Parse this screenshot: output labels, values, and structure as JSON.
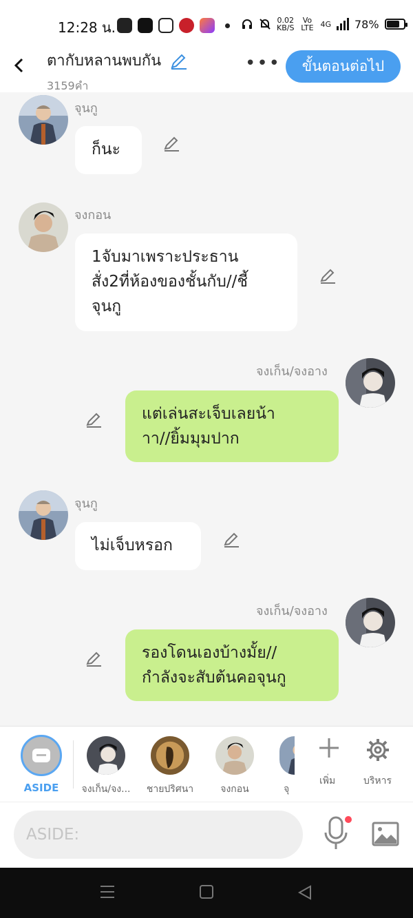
{
  "status_bar": {
    "time": "12:28 น.",
    "speed_value": "0.02",
    "speed_unit": "KB/S",
    "volte": "Vo LTE",
    "network": "4G",
    "battery": "78%",
    "battery_level": 0.78
  },
  "header": {
    "title": "ตากับหลานพบกัน",
    "word_count": "3159คำ",
    "next_button": "ขั้นตอนต่อไป"
  },
  "messages": [
    {
      "side": "left",
      "sender": "จุนกู",
      "lines": [
        "ก็นะ"
      ],
      "avatar": "jungu"
    },
    {
      "side": "left",
      "sender": "จงกอน",
      "lines": [
        "1จับมาเพราะประธาน",
        "สั่ง2ที่ห้องของชั้นกับ//ชี้",
        "จุนกู"
      ],
      "avatar": "jonggon"
    },
    {
      "side": "right",
      "sender": "จงเก็น/จงอาง",
      "lines": [
        "แต่เล่นสะเจ็บเลยน้า",
        "าา//ยิ้มมุมปาก"
      ],
      "avatar": "jonggen"
    },
    {
      "side": "left",
      "sender": "จุนกู",
      "lines": [
        "ไม่เจ็บหรอก"
      ],
      "avatar": "jungu"
    },
    {
      "side": "right",
      "sender": "จงเก็น/จงอาง",
      "lines": [
        "รองโดนเองบ้างมั้ย//",
        "กำลังจะสับต้นคอจุนกู"
      ],
      "avatar": "jonggen"
    }
  ],
  "character_bar": {
    "aside_label": "ASIDE",
    "characters": [
      {
        "label": "จงเก็น/จง..."
      },
      {
        "label": "ชายปริศนา"
      },
      {
        "label": "จงกอน"
      },
      {
        "label": "จุ"
      }
    ],
    "add_label": "เพิ่ม",
    "manage_label": "บริหาร"
  },
  "input": {
    "placeholder": "ASIDE:"
  },
  "colors": {
    "accent": "#4a9ff0",
    "bubble_right": "#c9ef8e",
    "bubble_left": "#ffffff",
    "background": "#f5f5f5"
  }
}
